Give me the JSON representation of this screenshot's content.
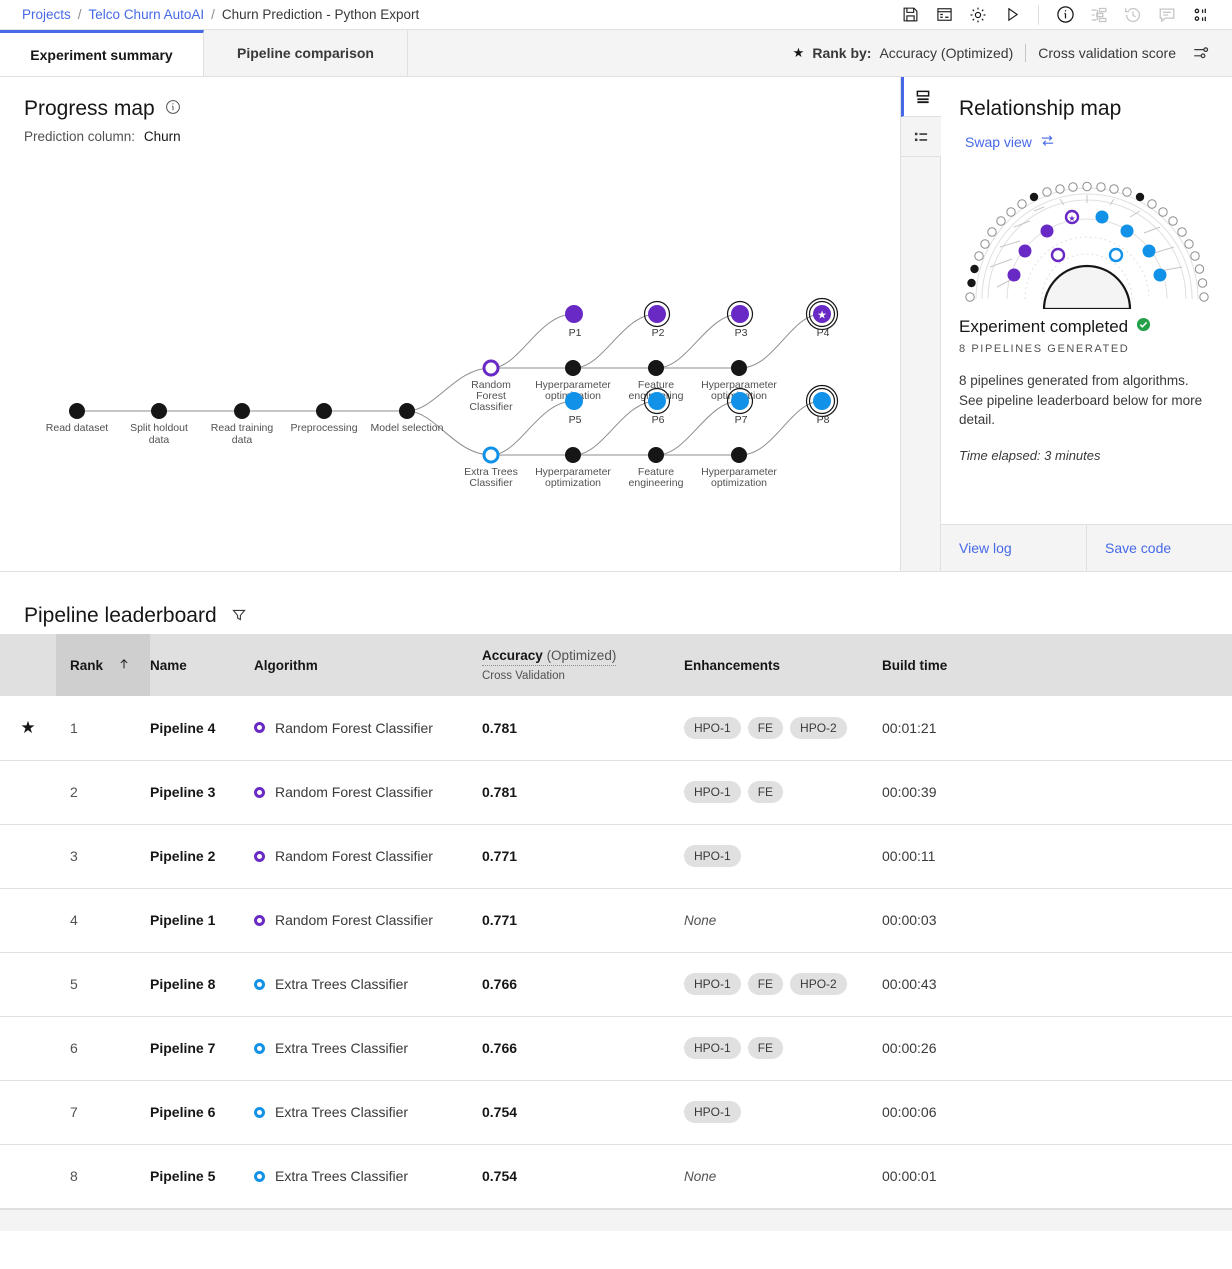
{
  "breadcrumb": {
    "items": [
      {
        "label": "Projects",
        "link": true
      },
      {
        "label": "Telco Churn AutoAI",
        "link": true
      },
      {
        "label": "Churn Prediction - Python Export",
        "link": false
      }
    ],
    "separator": "/"
  },
  "toolbar": {
    "icons": [
      {
        "name": "save-icon",
        "title": "Save",
        "disabled": false
      },
      {
        "name": "notebook-icon",
        "title": "Notebook",
        "disabled": false
      },
      {
        "name": "gear-icon",
        "title": "Settings",
        "disabled": false
      },
      {
        "name": "play-icon",
        "title": "Run",
        "disabled": false
      },
      {
        "name": "info-icon",
        "title": "Information",
        "disabled": false
      },
      {
        "name": "flow-icon",
        "title": "Flow",
        "disabled": true
      },
      {
        "name": "history-icon",
        "title": "History",
        "disabled": true
      },
      {
        "name": "comment-icon",
        "title": "Comments",
        "disabled": true
      },
      {
        "name": "grid-icon",
        "title": "Apps",
        "disabled": false
      }
    ]
  },
  "tabs": [
    {
      "label": "Experiment summary",
      "active": true
    },
    {
      "label": "Pipeline comparison",
      "active": false
    }
  ],
  "rank_by": {
    "star": "★",
    "label": "Rank by:",
    "metric": "Accuracy (Optimized)",
    "scope": "Cross validation score",
    "settings_icon": "sliders-icon"
  },
  "progress_map": {
    "title": "Progress map",
    "info_icon": "info-icon",
    "prediction_label": "Prediction column:",
    "prediction_value": "Churn",
    "stages": [
      "Read dataset",
      "Split holdout data",
      "Read training data",
      "Preprocessing",
      "Model selection"
    ],
    "branches": [
      {
        "algorithm": "Random Forest Classifier",
        "color": "#6929c4",
        "steps": [
          "Hyperparameter optimization",
          "Feature engineering",
          "Hyperparameter optimization"
        ],
        "pipelines": [
          {
            "label": "P1",
            "rings": 0,
            "star": false
          },
          {
            "label": "P2",
            "rings": 1,
            "star": false
          },
          {
            "label": "P3",
            "rings": 1,
            "star": false
          },
          {
            "label": "P4",
            "rings": 2,
            "star": true
          }
        ]
      },
      {
        "algorithm": "Extra Trees Classifier",
        "color": "#1192e8",
        "steps": [
          "Hyperparameter optimization",
          "Feature engineering",
          "Hyperparameter optimization"
        ],
        "pipelines": [
          {
            "label": "P5",
            "rings": 0,
            "star": false
          },
          {
            "label": "P6",
            "rings": 1,
            "star": false
          },
          {
            "label": "P7",
            "rings": 1,
            "star": false
          },
          {
            "label": "P8",
            "rings": 2,
            "star": false
          }
        ]
      }
    ]
  },
  "rail": [
    {
      "name": "panel-view-icon",
      "active": true
    },
    {
      "name": "list-view-icon",
      "active": false
    }
  ],
  "relationship_map": {
    "title": "Relationship map",
    "swap_view": "Swap view",
    "swap_icon": "swap-arrows-icon"
  },
  "experiment": {
    "status_title": "Experiment completed",
    "status_icon": "check-circle-icon",
    "status_color": "#24a148",
    "subtitle": "8 pipelines generated",
    "description": "8 pipelines generated from algorithms. See pipeline leaderboard below for more detail.",
    "time_elapsed": "Time elapsed: 3 minutes",
    "footer": [
      {
        "label": "View log"
      },
      {
        "label": "Save code"
      }
    ]
  },
  "leaderboard": {
    "title": "Pipeline leaderboard",
    "filter_icon": "filter-icon",
    "sort_icon": "arrow-up-icon",
    "columns": {
      "star": "",
      "rank": "Rank",
      "name": "Name",
      "algorithm": "Algorithm",
      "accuracy_main": "Accuracy",
      "accuracy_opt": "(Optimized)",
      "accuracy_sub": "Cross Validation",
      "enhancements": "Enhancements",
      "build_time": "Build time"
    },
    "rows": [
      {
        "star": true,
        "rank": "1",
        "name": "Pipeline 4",
        "algorithm": "Random Forest Classifier",
        "marker": "purple",
        "accuracy": "0.781",
        "tags": [
          "HPO-1",
          "FE",
          "HPO-2"
        ],
        "build_time": "00:01:21"
      },
      {
        "star": false,
        "rank": "2",
        "name": "Pipeline 3",
        "algorithm": "Random Forest Classifier",
        "marker": "purple",
        "accuracy": "0.781",
        "tags": [
          "HPO-1",
          "FE"
        ],
        "build_time": "00:00:39"
      },
      {
        "star": false,
        "rank": "3",
        "name": "Pipeline 2",
        "algorithm": "Random Forest Classifier",
        "marker": "purple",
        "accuracy": "0.771",
        "tags": [
          "HPO-1"
        ],
        "build_time": "00:00:11"
      },
      {
        "star": false,
        "rank": "4",
        "name": "Pipeline 1",
        "algorithm": "Random Forest Classifier",
        "marker": "purple",
        "accuracy": "0.771",
        "tags": [],
        "none_label": "None",
        "build_time": "00:00:03"
      },
      {
        "star": false,
        "rank": "5",
        "name": "Pipeline 8",
        "algorithm": "Extra Trees Classifier",
        "marker": "blue",
        "accuracy": "0.766",
        "tags": [
          "HPO-1",
          "FE",
          "HPO-2"
        ],
        "build_time": "00:00:43"
      },
      {
        "star": false,
        "rank": "6",
        "name": "Pipeline 7",
        "algorithm": "Extra Trees Classifier",
        "marker": "blue",
        "accuracy": "0.766",
        "tags": [
          "HPO-1",
          "FE"
        ],
        "build_time": "00:00:26"
      },
      {
        "star": false,
        "rank": "7",
        "name": "Pipeline 6",
        "algorithm": "Extra Trees Classifier",
        "marker": "blue",
        "accuracy": "0.754",
        "tags": [
          "HPO-1"
        ],
        "build_time": "00:00:06"
      },
      {
        "star": false,
        "rank": "8",
        "name": "Pipeline 5",
        "algorithm": "Extra Trees Classifier",
        "marker": "blue",
        "accuracy": "0.754",
        "tags": [],
        "none_label": "None",
        "build_time": "00:00:01"
      }
    ]
  },
  "colors": {
    "accent": "#4769e8",
    "purple": "#6929c4",
    "blue": "#1192e8",
    "green": "#24a148"
  }
}
